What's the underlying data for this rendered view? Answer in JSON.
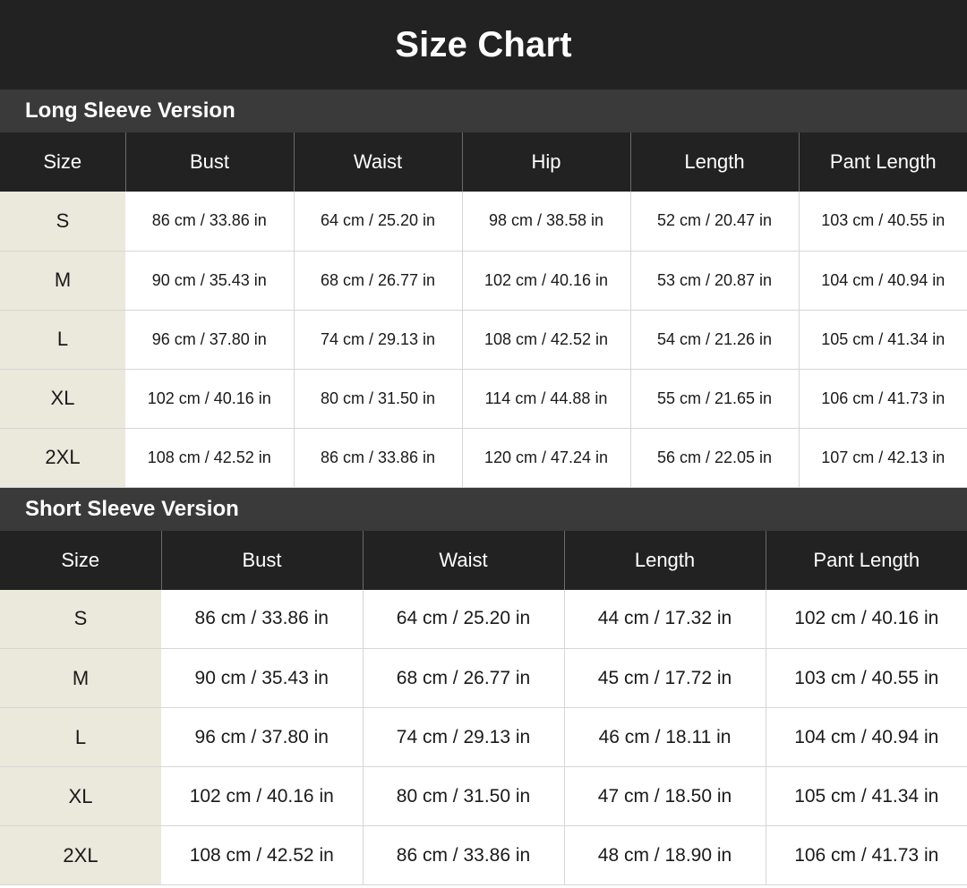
{
  "title": "Size Chart",
  "long_sleeve": {
    "heading": "Long Sleeve Version",
    "columns": [
      "Size",
      "Bust",
      "Waist",
      "Hip",
      "Length",
      "Pant Length"
    ],
    "rows": [
      [
        "S",
        "86 cm / 33.86 in",
        "64 cm / 25.20 in",
        "98 cm / 38.58 in",
        "52 cm / 20.47 in",
        "103 cm / 40.55 in"
      ],
      [
        "M",
        "90 cm / 35.43 in",
        "68 cm / 26.77 in",
        "102 cm / 40.16 in",
        "53 cm / 20.87 in",
        "104 cm / 40.94 in"
      ],
      [
        "L",
        "96 cm / 37.80 in",
        "74 cm / 29.13 in",
        "108 cm / 42.52 in",
        "54 cm / 21.26 in",
        "105 cm / 41.34 in"
      ],
      [
        "XL",
        "102 cm / 40.16 in",
        "80 cm / 31.50 in",
        "114 cm / 44.88 in",
        "55 cm / 21.65 in",
        "106 cm / 41.73 in"
      ],
      [
        "2XL",
        "108 cm / 42.52 in",
        "86 cm / 33.86 in",
        "120 cm / 47.24 in",
        "56 cm / 22.05 in",
        "107 cm / 42.13 in"
      ]
    ]
  },
  "short_sleeve": {
    "heading": "Short Sleeve Version",
    "columns": [
      "Size",
      "Bust",
      "Waist",
      "Length",
      "Pant Length"
    ],
    "rows": [
      [
        "S",
        "86 cm / 33.86 in",
        "64 cm / 25.20 in",
        "44 cm / 17.32 in",
        "102 cm / 40.16 in"
      ],
      [
        "M",
        "90 cm / 35.43 in",
        "68 cm / 26.77 in",
        "45 cm / 17.72 in",
        "103 cm / 40.55 in"
      ],
      [
        "L",
        "96 cm / 37.80 in",
        "74 cm / 29.13 in",
        "46 cm / 18.11 in",
        "104 cm / 40.94 in"
      ],
      [
        "XL",
        "102 cm / 40.16 in",
        "80 cm / 31.50 in",
        "47 cm / 18.50 in",
        "105 cm / 41.34 in"
      ],
      [
        "2XL",
        "108 cm / 42.52 in",
        "86 cm / 33.86 in",
        "48 cm / 18.90 in",
        "106 cm / 41.73 in"
      ]
    ]
  },
  "colors": {
    "title_bg": "#222222",
    "section_bg": "#3a3a3a",
    "header_bg": "#222222",
    "size_col_bg": "#ebe8dc"
  }
}
